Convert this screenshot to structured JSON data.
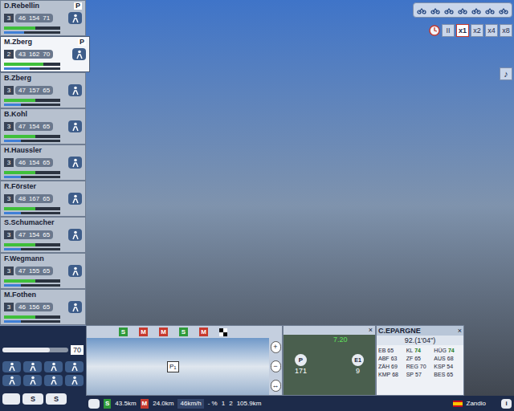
{
  "riders": [
    {
      "name": "D.Rebellin",
      "role": "P",
      "number": "3",
      "stats": [
        "46",
        "154",
        "71"
      ],
      "energy": 0.55,
      "form": 0.35,
      "selected": false
    },
    {
      "name": "M.Zberg",
      "role": "P",
      "number": "2",
      "stats": [
        "43",
        "162",
        "70"
      ],
      "energy": 0.7,
      "form": 0.45,
      "selected": true
    },
    {
      "name": "B.Zberg",
      "role": "",
      "number": "3",
      "stats": [
        "47",
        "157",
        "65"
      ],
      "energy": 0.55,
      "form": 0.3,
      "selected": false
    },
    {
      "name": "B.Kohl",
      "role": "",
      "number": "3",
      "stats": [
        "47",
        "154",
        "65"
      ],
      "energy": 0.55,
      "form": 0.3,
      "selected": false
    },
    {
      "name": "H.Haussler",
      "role": "",
      "number": "3",
      "stats": [
        "46",
        "154",
        "65"
      ],
      "energy": 0.55,
      "form": 0.3,
      "selected": false
    },
    {
      "name": "R.Förster",
      "role": "",
      "number": "3",
      "stats": [
        "48",
        "167",
        "65"
      ],
      "energy": 0.55,
      "form": 0.3,
      "selected": false
    },
    {
      "name": "S.Schumacher",
      "role": "",
      "number": "3",
      "stats": [
        "47",
        "154",
        "65"
      ],
      "energy": 0.55,
      "form": 0.3,
      "selected": false
    },
    {
      "name": "F.Wegmann",
      "role": "",
      "number": "3",
      "stats": [
        "47",
        "155",
        "65"
      ],
      "energy": 0.55,
      "form": 0.3,
      "selected": false
    },
    {
      "name": "M.Fothen",
      "role": "",
      "number": "3",
      "stats": [
        "46",
        "156",
        "65"
      ],
      "energy": 0.55,
      "form": 0.3,
      "selected": false
    }
  ],
  "speed_buttons": [
    {
      "label": "II",
      "selected": false
    },
    {
      "label": "x1",
      "selected": true
    },
    {
      "label": "x2",
      "selected": false
    },
    {
      "label": "x4",
      "selected": false
    },
    {
      "label": "x8",
      "selected": false
    }
  ],
  "music_button": "♪",
  "effort": {
    "reading": "70",
    "level": 0.72
  },
  "profile": {
    "markers": [
      {
        "label": "S",
        "color": "#2f9a3a"
      },
      {
        "label": "M",
        "color": "#c63a2f"
      },
      {
        "label": "M",
        "color": "#c63a2f"
      },
      {
        "label": "S",
        "color": "#2f9a3a"
      },
      {
        "label": "M",
        "color": "#c63a2f"
      }
    ],
    "point_label": "P",
    "point_number": "1",
    "zoom": [
      "+",
      "−",
      "↔"
    ]
  },
  "map": {
    "close": "×",
    "time": "7.20",
    "start": "P",
    "end": "E1",
    "start_value": "171",
    "end_value": "9"
  },
  "rider_card": {
    "team": "C.EPARGNE",
    "close": "×",
    "position": "92.(1'04'')",
    "stats": [
      {
        "label": "EB",
        "value": "65",
        "highlighted": false
      },
      {
        "label": "KL",
        "value": "74",
        "highlighted": true
      },
      {
        "label": "HÜG",
        "value": "74",
        "highlighted": true
      },
      {
        "label": "ABF",
        "value": "63",
        "highlighted": false
      },
      {
        "label": "ZF",
        "value": "65",
        "highlighted": false
      },
      {
        "label": "AUS",
        "value": "68",
        "highlighted": false
      },
      {
        "label": "ZÄH",
        "value": "69",
        "highlighted": false
      },
      {
        "label": "REG",
        "value": "70",
        "highlighted": false
      },
      {
        "label": "KSP",
        "value": "54",
        "highlighted": false
      },
      {
        "label": "KMP",
        "value": "68",
        "highlighted": false
      },
      {
        "label": "SP",
        "value": "57",
        "highlighted": false
      },
      {
        "label": "BES",
        "value": "65",
        "highlighted": false
      }
    ],
    "rider": "Zandio"
  },
  "left_buttons": [
    "S",
    "S"
  ],
  "status": {
    "sprint_label": "S",
    "sprint": "43.5km",
    "mountain_label": "M",
    "mountain": "24.0km",
    "speed": "46km/h",
    "gradient": "- %",
    "group": "1",
    "count": "2",
    "remaining": "105.9km",
    "info": "i"
  }
}
